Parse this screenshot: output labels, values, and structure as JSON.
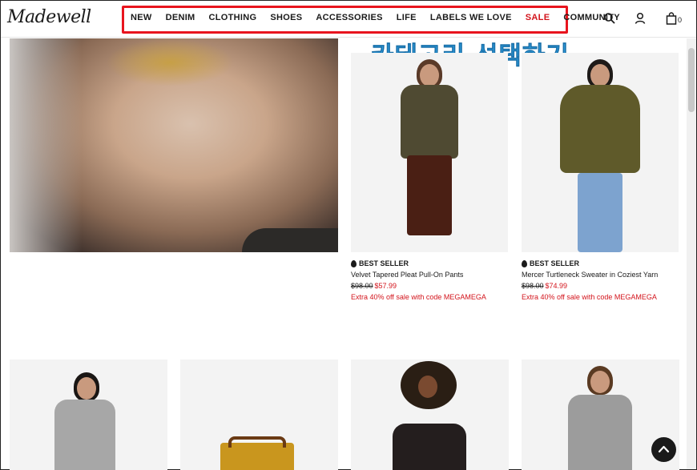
{
  "brand": {
    "logo_text": "Madewell"
  },
  "nav": {
    "items": [
      {
        "label": "NEW"
      },
      {
        "label": "DENIM"
      },
      {
        "label": "CLOTHING"
      },
      {
        "label": "SHOES"
      },
      {
        "label": "ACCESSORIES"
      },
      {
        "label": "LIFE"
      },
      {
        "label": "LABELS WE LOVE"
      },
      {
        "label": "SALE"
      },
      {
        "label": "COMMUNITY"
      }
    ]
  },
  "header_icons": {
    "search": "search-icon",
    "account": "user-icon",
    "bag": "bag-icon",
    "bag_count": "0"
  },
  "annotation": {
    "text": "카테고리 선택하기"
  },
  "products": [
    {
      "badge": "BEST SELLER",
      "name": "Velvet Tapered Pleat Pull-On Pants",
      "was_price": "$98.00",
      "now_price": "$57.99",
      "promo": "Extra 40% off sale with code MEGAMEGA"
    },
    {
      "badge": "BEST SELLER",
      "name": "Mercer Turtleneck Sweater in Coziest Yarn",
      "was_price": "$98.00",
      "now_price": "$74.99",
      "promo": "Extra 40% off sale with code MEGAMEGA"
    }
  ],
  "colors": {
    "accent_red": "#d3141c",
    "annotation_blue": "#2e9fe0",
    "highlight_box": "#e8141e"
  },
  "controls": {
    "back_to_top": "arrow-up-icon"
  }
}
